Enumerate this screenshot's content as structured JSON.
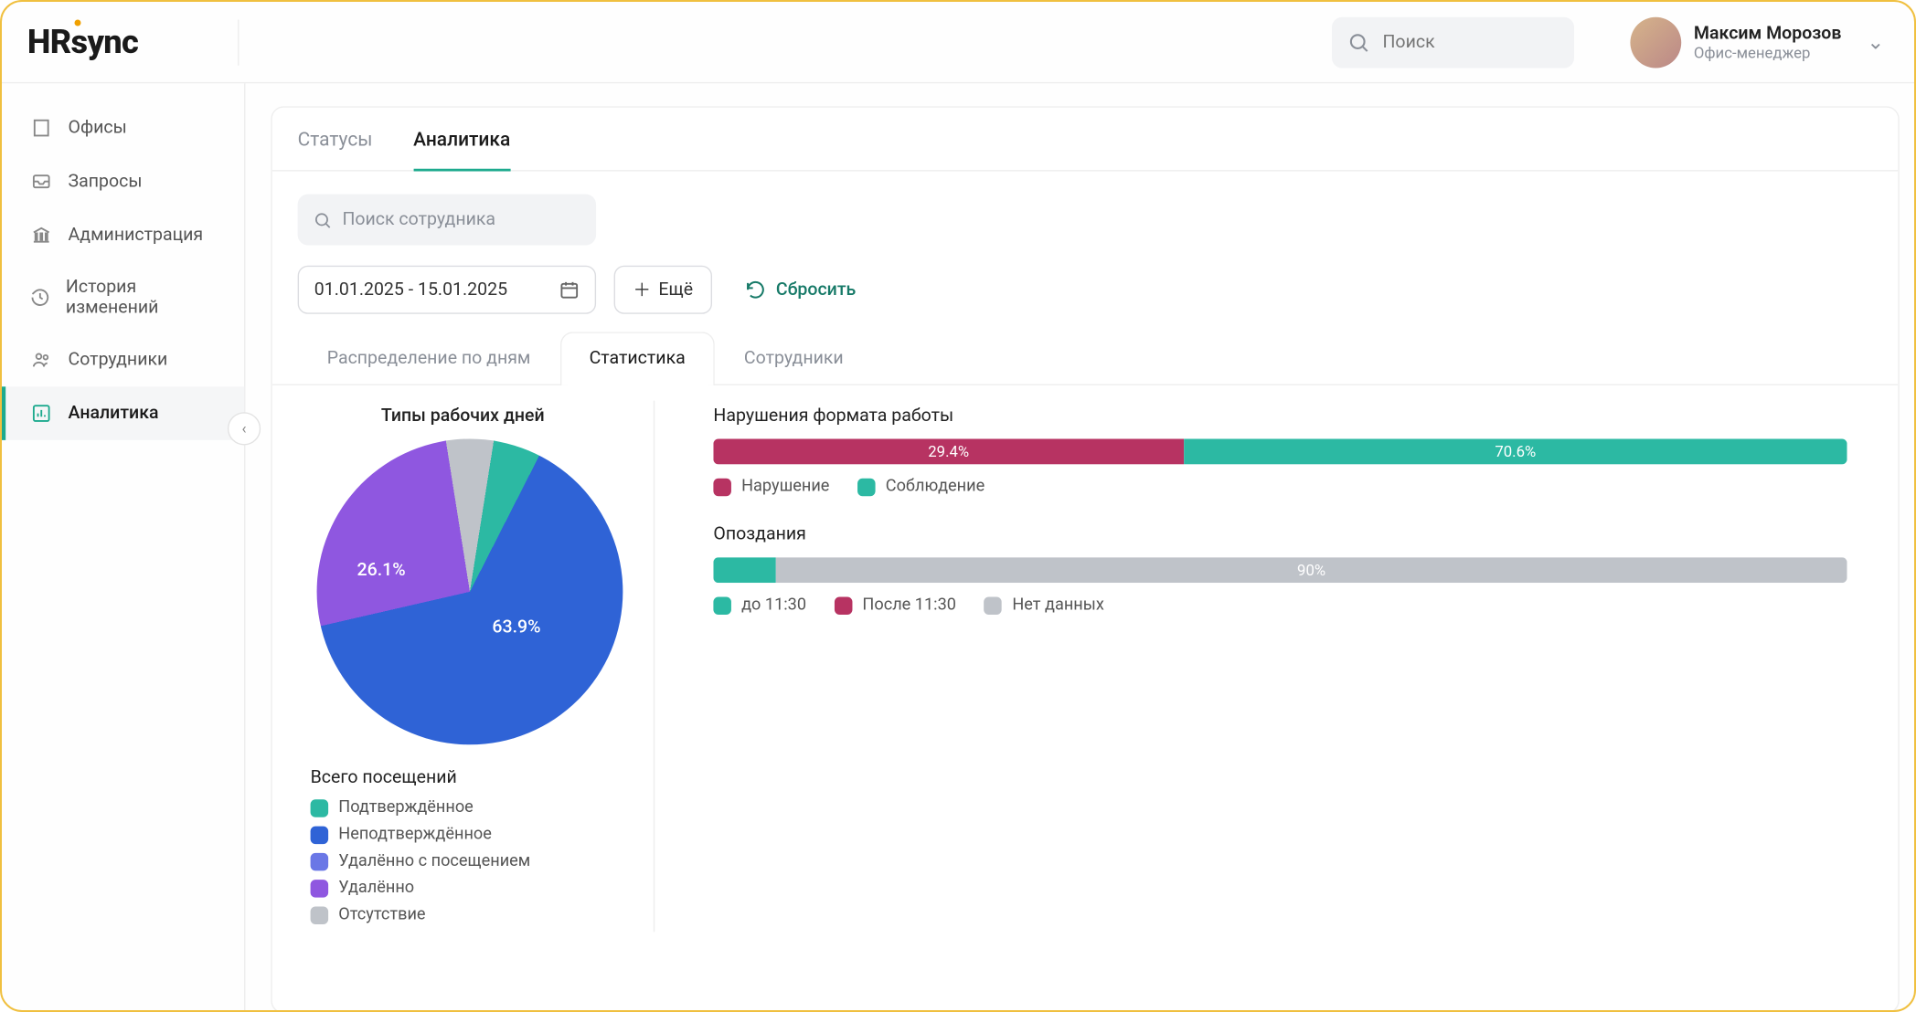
{
  "header": {
    "logo": "HRsync",
    "search_placeholder": "Поиск",
    "user_name": "Максим Морозов",
    "user_role": "Офис-менеджер"
  },
  "sidebar": {
    "items": [
      {
        "label": "Офисы"
      },
      {
        "label": "Запросы"
      },
      {
        "label": "Администрация"
      },
      {
        "label": "История изменений"
      },
      {
        "label": "Сотрудники"
      },
      {
        "label": "Аналитика"
      }
    ]
  },
  "tabs": {
    "statuses": "Статусы",
    "analytics": "Аналитика"
  },
  "toolbar": {
    "emp_search_placeholder": "Поиск сотрудника",
    "date_range": "01.01.2025 - 15.01.2025",
    "more": "Ещё",
    "reset": "Сбросить"
  },
  "subtabs": {
    "by_days": "Распределение по дням",
    "stats": "Статистика",
    "employees": "Сотрудники"
  },
  "pie": {
    "title": "Типы рабочих дней",
    "legend_title": "Всего посещений",
    "legend": [
      {
        "label": "Подтверждённое",
        "color": "#2cb9a3"
      },
      {
        "label": "Неподтверждённое",
        "color": "#2f63d6"
      },
      {
        "label": "Удалённо с посещением",
        "color": "#6a77e6"
      },
      {
        "label": "Удалённо",
        "color": "#8f57e0"
      },
      {
        "label": "Отсутствие",
        "color": "#bfc3c9"
      }
    ],
    "label_main": "63.9%",
    "label_sec": "26.1%"
  },
  "violations": {
    "title": "Нарушения формата работы",
    "seg1": {
      "label": "29.4%",
      "pct": 41.5,
      "color": "#b73362"
    },
    "seg2": {
      "label": "70.6%",
      "pct": 58.5,
      "color": "#2cb9a3"
    },
    "legend": [
      {
        "label": "Нарушение",
        "color": "#b73362"
      },
      {
        "label": "Соблюдение",
        "color": "#2cb9a3"
      }
    ]
  },
  "late": {
    "title": "Опоздания",
    "seg1": {
      "label": "",
      "pct": 5.5,
      "color": "#2cb9a3"
    },
    "seg2": {
      "label": "90%",
      "pct": 94.5,
      "color": "#bfc3c9"
    },
    "legend": [
      {
        "label": "до 11:30",
        "color": "#2cb9a3"
      },
      {
        "label": "После 11:30",
        "color": "#b73362"
      },
      {
        "label": "Нет данных",
        "color": "#bfc3c9"
      }
    ]
  },
  "chart_data": [
    {
      "type": "pie",
      "title": "Типы рабочих дней",
      "series": [
        {
          "name": "Неподтверждённое",
          "value": 63.9,
          "color": "#2f63d6"
        },
        {
          "name": "Удалённо",
          "value": 26.1,
          "color": "#8f57e0"
        },
        {
          "name": "Отсутствие",
          "value": 5.0,
          "color": "#bfc3c9"
        },
        {
          "name": "Подтверждённое",
          "value": 5.0,
          "color": "#2cb9a3"
        }
      ],
      "labels_shown": [
        "63.9%",
        "26.1%"
      ]
    },
    {
      "type": "bar",
      "title": "Нарушения формата работы",
      "orientation": "horizontal-stacked",
      "series": [
        {
          "name": "Нарушение",
          "value": 29.4,
          "color": "#b73362"
        },
        {
          "name": "Соблюдение",
          "value": 70.6,
          "color": "#2cb9a3"
        }
      ],
      "ylim": [
        0,
        100
      ]
    },
    {
      "type": "bar",
      "title": "Опоздания",
      "orientation": "horizontal-stacked",
      "series": [
        {
          "name": "до 11:30",
          "value": 10,
          "color": "#2cb9a3"
        },
        {
          "name": "После 11:30",
          "value": 0,
          "color": "#b73362"
        },
        {
          "name": "Нет данных",
          "value": 90,
          "color": "#bfc3c9"
        }
      ],
      "ylim": [
        0,
        100
      ]
    }
  ]
}
